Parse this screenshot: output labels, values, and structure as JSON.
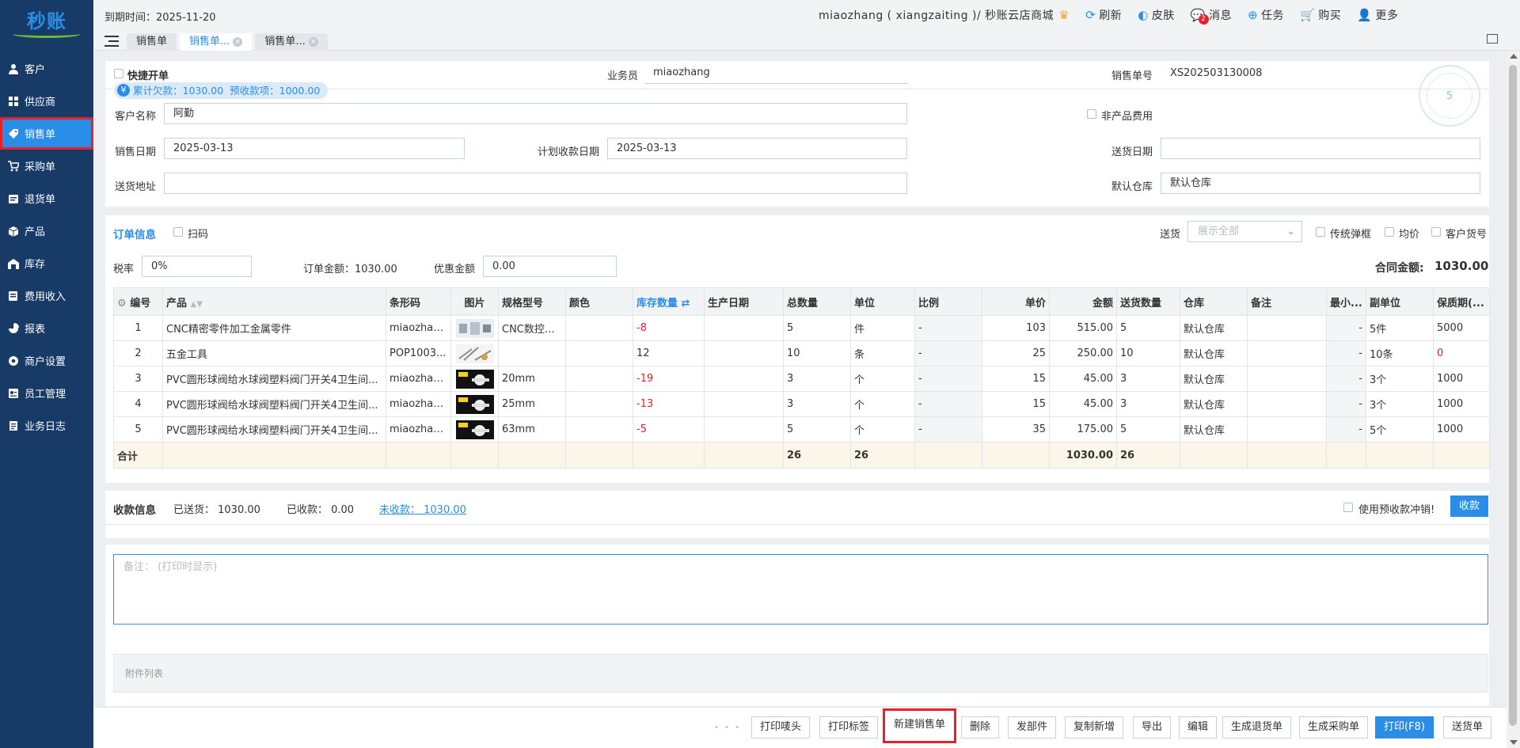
{
  "app": {
    "logo": "秒账"
  },
  "sidebar": {
    "items": [
      {
        "label": "客户",
        "icon": "user-icon"
      },
      {
        "label": "供应商",
        "icon": "supplier-icon"
      },
      {
        "label": "销售单",
        "icon": "tag-icon"
      },
      {
        "label": "采购单",
        "icon": "cart-icon"
      },
      {
        "label": "退货单",
        "icon": "return-icon"
      },
      {
        "label": "产品",
        "icon": "box-icon"
      },
      {
        "label": "库存",
        "icon": "warehouse-icon"
      },
      {
        "label": "费用收入",
        "icon": "finance-icon"
      },
      {
        "label": "报表",
        "icon": "chart-icon"
      },
      {
        "label": "商户设置",
        "icon": "settings-icon"
      },
      {
        "label": "员工管理",
        "icon": "staff-icon"
      },
      {
        "label": "业务日志",
        "icon": "log-icon"
      }
    ]
  },
  "header": {
    "expire": "到期时间：2025-11-20",
    "user": "miaozhang ( xiangzaiting )/ 秒账云店商城",
    "refresh": "刷新",
    "skin": "皮肤",
    "messages": "消息",
    "message_count": "2",
    "tasks": "任务",
    "buy": "购买",
    "more": "更多"
  },
  "tabs": [
    {
      "label": "销售单"
    },
    {
      "label": "销售单...",
      "close": "×"
    },
    {
      "label": "销售单...",
      "close": "×"
    }
  ],
  "form": {
    "quick_open": "快捷开单",
    "salesman_label": "业务员",
    "salesman": "miaozhang",
    "order_no_label": "销售单号",
    "order_no": "XS202503130008",
    "arrears": "累计欠款：1030.00",
    "prepay": "预收款项：1000.00",
    "yen": "¥",
    "customer_label": "客户名称",
    "customer": "阿勤",
    "non_product_fee": "非产品费用",
    "sale_date_label": "销售日期",
    "sale_date": "2025-03-13",
    "plan_date_label": "计划收款日期",
    "plan_date": "2025-03-13",
    "delivery_date_label": "送货日期",
    "delivery_date": "",
    "address_label": "送货地址",
    "address": "",
    "warehouse_label": "默认仓库",
    "warehouse": "默认仓库",
    "stamp": "5"
  },
  "order": {
    "title": "订单信息",
    "scan": "扫码",
    "delivery_label": "送货",
    "delivery_select": "展示全部",
    "traditional_popup": "传统弹框",
    "avg_price": "均价",
    "customer_item_no": "客户货号",
    "tax_label": "税率",
    "tax": "0%",
    "order_amount": "订单金额：1030.00",
    "discount_label": "优惠金额",
    "discount": "0.00",
    "contract_label": "合同金额:",
    "contract": "1030.00"
  },
  "table": {
    "columns": [
      "编号",
      "产品",
      "条形码",
      "图片",
      "规格型号",
      "颜色",
      "库存数量",
      "生产日期",
      "总数量",
      "单位",
      "比例",
      "单价",
      "金额",
      "送货数量",
      "仓库",
      "备注",
      "最小...",
      "副单位",
      "保质期(..."
    ],
    "rows": [
      {
        "no": "1",
        "product": "CNC精密零件加工金属零件",
        "barcode": "miaozhan...",
        "spec": "CNC数控车...",
        "color": "",
        "stock": "-8",
        "date": "",
        "qty": "5",
        "unit": "件",
        "ratio": "-",
        "price": "103",
        "amount": "515.00",
        "deliver": "5",
        "warehouse": "默认仓库",
        "note": "",
        "min": "-",
        "subunit": "5件",
        "shelf": "5000"
      },
      {
        "no": "2",
        "product": "五金工具",
        "barcode": "POP1003...",
        "spec": "",
        "color": "",
        "stock": "12",
        "date": "",
        "qty": "10",
        "unit": "条",
        "ratio": "-",
        "price": "25",
        "amount": "250.00",
        "deliver": "10",
        "warehouse": "默认仓库",
        "note": "",
        "min": "-",
        "subunit": "10条",
        "shelf": "0"
      },
      {
        "no": "3",
        "product": "PVC圆形球阀给水球阀塑料阀门开关4卫生间...",
        "barcode": "miaozhan...",
        "spec": "20mm",
        "color": "",
        "stock": "-19",
        "date": "",
        "qty": "3",
        "unit": "个",
        "ratio": "-",
        "price": "15",
        "amount": "45.00",
        "deliver": "3",
        "warehouse": "默认仓库",
        "note": "",
        "min": "-",
        "subunit": "3个",
        "shelf": "1000"
      },
      {
        "no": "4",
        "product": "PVC圆形球阀给水球阀塑料阀门开关4卫生间...",
        "barcode": "miaozhan...",
        "spec": "25mm",
        "color": "",
        "stock": "-13",
        "date": "",
        "qty": "3",
        "unit": "个",
        "ratio": "-",
        "price": "15",
        "amount": "45.00",
        "deliver": "3",
        "warehouse": "默认仓库",
        "note": "",
        "min": "-",
        "subunit": "3个",
        "shelf": "1000"
      },
      {
        "no": "5",
        "product": "PVC圆形球阀给水球阀塑料阀门开关4卫生间...",
        "barcode": "miaozhan...",
        "spec": "63mm",
        "color": "",
        "stock": "-5",
        "date": "",
        "qty": "5",
        "unit": "个",
        "ratio": "-",
        "price": "35",
        "amount": "175.00",
        "deliver": "5",
        "warehouse": "默认仓库",
        "note": "",
        "min": "-",
        "subunit": "5个",
        "shelf": "1000"
      }
    ],
    "total_label": "合计",
    "total_qty": "26",
    "total_unit": "26",
    "total_amount": "1030.00",
    "total_deliver": "26"
  },
  "payment": {
    "title": "收款信息",
    "shipped": "已送货：  1030.00",
    "received": "已收款：  0.00",
    "unpaid": "未收款：  1030.00",
    "use_prepay": "使用预收款冲销!",
    "collect": "收款"
  },
  "remark": {
    "placeholder": "备注：  (打印时显示)"
  },
  "attachments": {
    "title": "附件列表"
  },
  "actions": {
    "ellipsis": "• • •",
    "print_label_head": "打印唛头",
    "print_tag": "打印标签",
    "new_sale": "新建销售单",
    "delete": "删除",
    "send": "发部件",
    "copy_new": "复制新增",
    "export": "导出",
    "edit": "编辑",
    "gen_return": "生成退货单",
    "gen_purchase": "生成采购单",
    "print": "打印(F8)",
    "delivery_note": "送货单"
  },
  "colors": {
    "sidebar": "#173a66",
    "accent": "#2a8ee8",
    "highlight": "#e8202a",
    "negative": "#e8202a"
  }
}
